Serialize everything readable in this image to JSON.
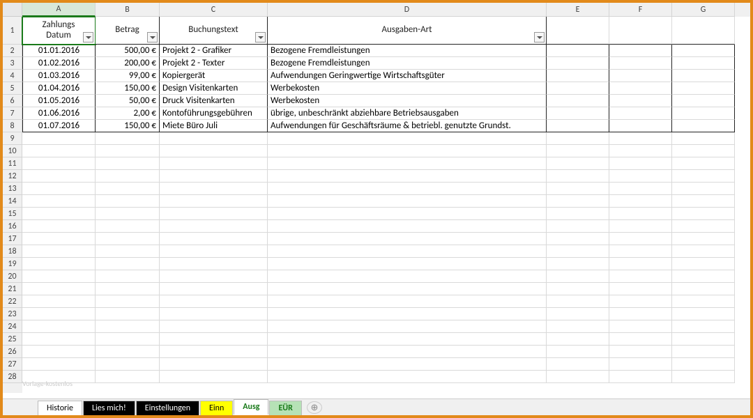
{
  "columns": {
    "A": "A",
    "B": "B",
    "C": "C",
    "D": "D",
    "E": "E",
    "F": "F",
    "G": "G"
  },
  "headers": {
    "A": "Zahlungs\nDatum",
    "B": "Betrag",
    "C": "Buchungstext",
    "D": "Ausgaben-Art"
  },
  "rows": [
    {
      "date": "01.01.2016",
      "amount": "500,00 €",
      "text": "Projekt 2 - Grafiker",
      "type": "Bezogene Fremdleistungen"
    },
    {
      "date": "01.02.2016",
      "amount": "200,00 €",
      "text": "Projekt 2 - Texter",
      "type": "Bezogene Fremdleistungen"
    },
    {
      "date": "01.03.2016",
      "amount": "99,00 €",
      "text": "Kopiergerät",
      "type": "Aufwendungen Geringwertige Wirtschaftsgüter"
    },
    {
      "date": "01.04.2016",
      "amount": "150,00 €",
      "text": "Design Visitenkarten",
      "type": "Werbekosten"
    },
    {
      "date": "01.05.2016",
      "amount": "50,00 €",
      "text": "Druck Visitenkarten",
      "type": "Werbekosten"
    },
    {
      "date": "01.06.2016",
      "amount": "2,00 €",
      "text": "Kontoführungsgebühren",
      "type": "übrige, unbeschränkt abziehbare Betriebsausgaben"
    },
    {
      "date": "01.07.2016",
      "amount": "150,00 €",
      "text": "Miete Büro Juli",
      "type": "Aufwendungen für Geschäftsräume & betriebl. genutzte Grundst."
    }
  ],
  "row_numbers": [
    "1",
    "2",
    "3",
    "4",
    "5",
    "6",
    "7",
    "8",
    "9",
    "10",
    "11",
    "12",
    "13",
    "14",
    "15",
    "16",
    "17",
    "18",
    "19",
    "20",
    "21",
    "22",
    "23",
    "24",
    "25",
    "26",
    "27",
    "28"
  ],
  "tabs": {
    "historie": "Historie",
    "lies": "Lies mich!",
    "einst": "Einstellungen",
    "einn": "Einn",
    "ausg": "Ausg",
    "eur": "EÜR"
  },
  "watermark": "Vorlage-kostenlos"
}
